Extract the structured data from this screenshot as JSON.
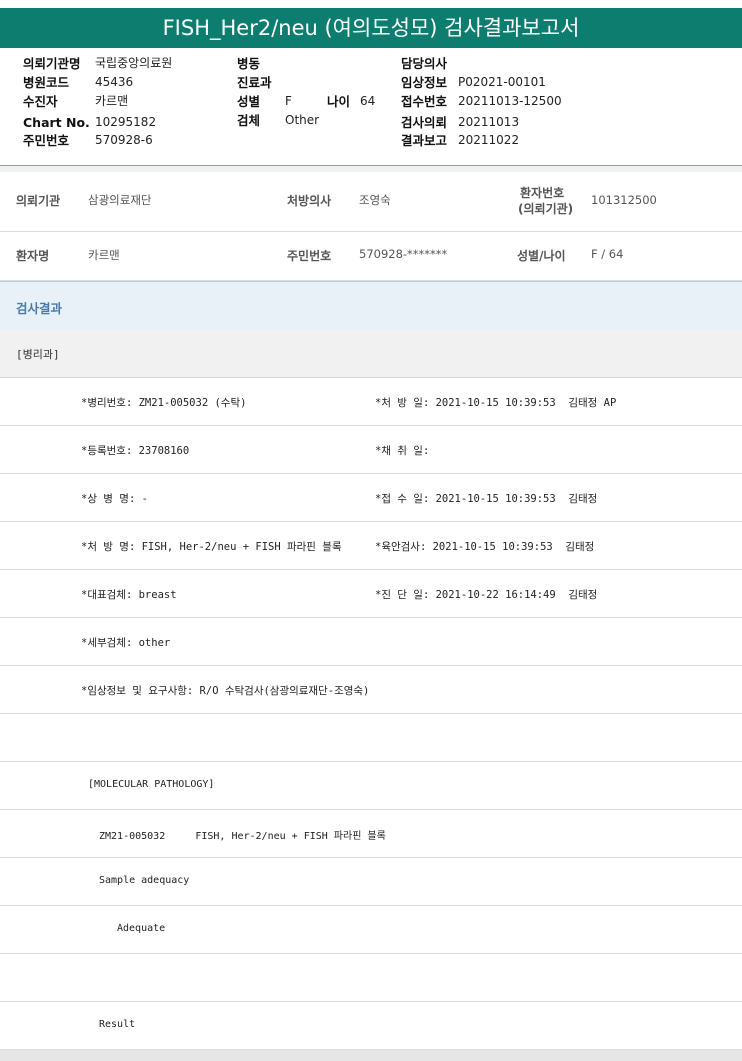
{
  "report": {
    "title": "FISH_Her2/neu (여의도성모) 검사결과보고서"
  },
  "header": {
    "col1": [
      {
        "label": "의뢰기관명",
        "value": "국립중앙의료원"
      },
      {
        "label": "병원코드",
        "value": "45436"
      },
      {
        "label": "수진자",
        "value": "카르맨"
      },
      {
        "label": "Chart No.",
        "value": "10295182"
      },
      {
        "label": "주민번호",
        "value": "570928-6"
      }
    ],
    "col2": [
      {
        "label": "병동",
        "value": ""
      },
      {
        "label": "진료과",
        "value": ""
      },
      {
        "label": "성별",
        "value": "F"
      },
      {
        "label": "검체",
        "value": "Other"
      }
    ],
    "age_label": "나이",
    "age_value": "64",
    "col3": [
      {
        "label": "담당의사",
        "value": ""
      },
      {
        "label": "임상정보",
        "value": "P02021-00101"
      },
      {
        "label": "접수번호",
        "value": "20211013-12500"
      },
      {
        "label": "검사의뢰",
        "value": "20211013"
      },
      {
        "label": "결과보고",
        "value": "20211022"
      }
    ]
  },
  "info": {
    "row1": {
      "inst_label": "의뢰기관",
      "inst_value": "삼광의료재단",
      "doctor_label": "처방의사",
      "doctor_value": "조영숙",
      "patno_label_1": "환자번호",
      "patno_label_2": "(의뢰기관)",
      "patno_value": "101312500"
    },
    "row2": {
      "name_label": "환자명",
      "name_value": "카르맨",
      "rrn_label": "주민번호",
      "rrn_value": "570928-*******",
      "sexage_label": "성별/나이",
      "sexage_value": "F / 64"
    }
  },
  "results": {
    "section_title": "검사결과",
    "department": "[병리과]",
    "lines": [
      {
        "left": "*병리번호: ZM21-005032 (수탁)",
        "right": "*처 방 일: 2021-10-15 10:39:53  김태정 AP"
      },
      {
        "left": "*등록번호: 23708160",
        "right": "*채 취 일:"
      },
      {
        "left": "*상 병 명: -",
        "right": "*접 수 일: 2021-10-15 10:39:53  김태정"
      },
      {
        "left": "*처 방 명: FISH, Her-2/neu + FISH 파라핀 블록",
        "right": "*육안검사: 2021-10-15 10:39:53  김태정"
      },
      {
        "left": "*대표검체: breast",
        "right": "*진 단 일: 2021-10-22 16:14:49  김태정"
      },
      {
        "left": "*세부검체: other",
        "right": ""
      },
      {
        "left": "*임상정보 및 요구사항: R/O 수탁검사(삼광의료재단-조영숙)",
        "right": ""
      }
    ],
    "mp_title": "[MOLECULAR PATHOLOGY]",
    "mp_line": "ZM21-005032     FISH, Her-2/neu + FISH 파라핀 블록",
    "sample_adequacy": "Sample adequacy",
    "adequate": "Adequate",
    "result": "Result"
  }
}
